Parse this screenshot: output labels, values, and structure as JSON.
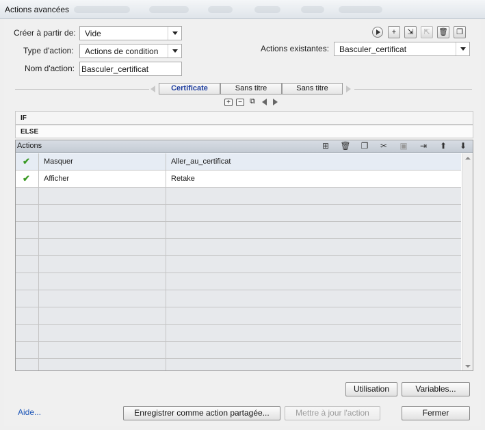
{
  "window": {
    "title": "Actions avancées"
  },
  "form": {
    "create_from_label": "Créer à partir de:",
    "create_from_value": "Vide",
    "action_type_label": "Type d'action:",
    "action_type_value": "Actions de condition",
    "action_name_label": "Nom d'action:",
    "action_name_value": "Basculer_certificat",
    "existing_label": "Actions existantes:",
    "existing_value": "Basculer_certificat"
  },
  "toolbar": {
    "icons": [
      "play-icon",
      "add-icon",
      "import-icon",
      "export-icon",
      "delete-icon",
      "duplicate-icon"
    ]
  },
  "tabs": [
    {
      "label": "Certificate",
      "active": true
    },
    {
      "label": "Sans titre",
      "active": false
    },
    {
      "label": "Sans titre",
      "active": false
    }
  ],
  "conditions": {
    "if_label": "IF",
    "else_label": "ELSE"
  },
  "grid": {
    "header": "Actions",
    "header_icons": [
      "add-row-icon",
      "trash-icon",
      "copy-icon",
      "cut-icon",
      "paste-icon",
      "insert-icon",
      "move-up-icon",
      "move-down-icon"
    ],
    "rows": [
      {
        "check": "✔",
        "action": "Masquer",
        "target": "Aller_au_certificat"
      },
      {
        "check": "✔",
        "action": "Afficher",
        "target": "Retake"
      }
    ],
    "empty_rows": 11
  },
  "buttons": {
    "usage": "Utilisation",
    "variables": "Variables...",
    "save_shared": "Enregistrer comme action partagée...",
    "update": "Mettre à jour l'action",
    "close": "Fermer",
    "help": "Aide..."
  }
}
